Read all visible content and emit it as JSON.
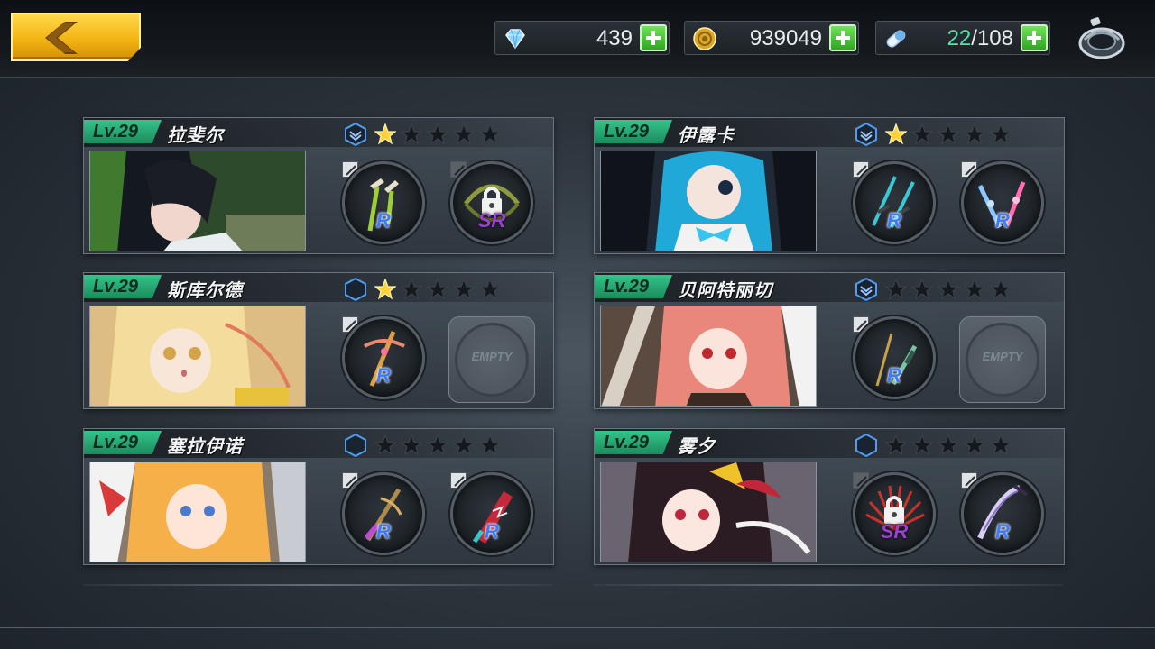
{
  "resources": {
    "gems": "439",
    "coins": "939049",
    "stamina_current": "22",
    "stamina_separator": "/",
    "stamina_max": "108"
  },
  "characters": [
    {
      "level": "Lv.29",
      "name": "拉斐尔",
      "stars": 1,
      "slot1": "R",
      "slot2": "SR"
    },
    {
      "level": "Lv.29",
      "name": "伊露卡",
      "stars": 1,
      "slot1": "R",
      "slot2": "R"
    },
    {
      "level": "Lv.29",
      "name": "斯库尔德",
      "stars": 1,
      "slot1": "R",
      "slot2": "EMPTY"
    },
    {
      "level": "Lv.29",
      "name": "贝阿特丽切",
      "stars": 0,
      "slot1": "R",
      "slot2": "EMPTY"
    },
    {
      "level": "Lv.29",
      "name": "塞拉伊诺",
      "stars": 0,
      "slot1": "R",
      "slot2": "R"
    },
    {
      "level": "Lv.29",
      "name": "雾夕",
      "stars": 0,
      "slot1": "SR",
      "slot2": "R"
    }
  ],
  "colors": {
    "accent_green": "#35c48a",
    "back_button": "#f3b514",
    "rarity_r": "#3a7bff",
    "rarity_sr": "#9b3fd0",
    "star_filled": "#ffd23a"
  },
  "icons": {
    "back": "chevron-left-icon",
    "gems": "diamond-icon",
    "coins": "coin-icon",
    "stamina": "pill-icon",
    "settings": "settings-ring-icon",
    "lock": "lock-icon",
    "edit": "edit-icon",
    "rank": "rank-badge-icon",
    "star": "star-icon"
  }
}
